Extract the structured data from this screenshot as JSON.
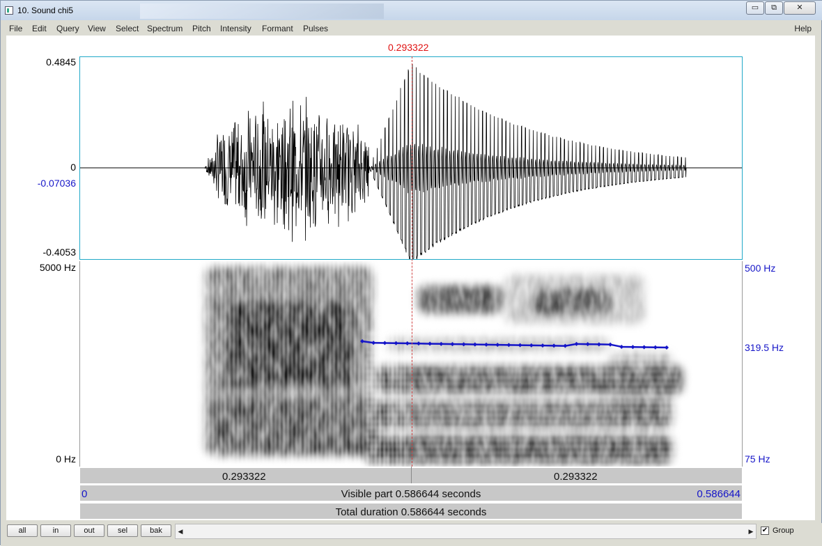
{
  "window": {
    "title": "10. Sound chi5",
    "buttons": [
      "▭",
      "⧉",
      "✕"
    ]
  },
  "menu": {
    "items": [
      "File",
      "Edit",
      "Query",
      "View",
      "Select",
      "Spectrum",
      "Pitch",
      "Intensity",
      "Formant",
      "Pulses"
    ],
    "help": "Help"
  },
  "cursor_time": "0.293322",
  "waveform": {
    "ymax": "0.4845",
    "zero": "0",
    "cursor_value": "-0.07036",
    "ymin": "-0.4053"
  },
  "spectrogram": {
    "ymax": "5000 Hz",
    "ymin": "0 Hz",
    "pitch_max": "500 Hz",
    "pitch_cursor": "319.5 Hz",
    "pitch_min": "75 Hz",
    "pitch_color": "#1515c8"
  },
  "time_bars": {
    "left_segment": "0.293322",
    "right_segment": "0.293322",
    "visible_start": "0",
    "visible_label": "Visible part 0.586644 seconds",
    "visible_end": "0.586644",
    "total_label": "Total duration 0.586644 seconds"
  },
  "buttons": {
    "all": "all",
    "in": "in",
    "out": "out",
    "sel": "sel",
    "bak": "bak"
  },
  "group": {
    "label": "Group",
    "checked": true,
    "mark": "✔"
  },
  "scroll_arrows": {
    "left": "◀",
    "right": "▶"
  }
}
